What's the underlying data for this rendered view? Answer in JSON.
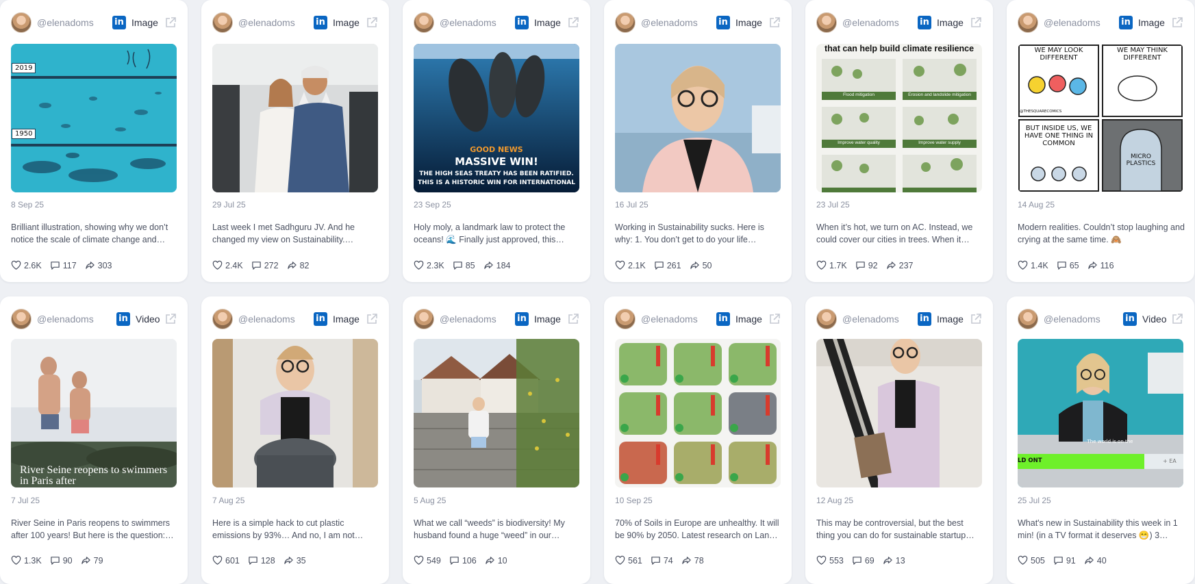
{
  "colors": {
    "linkedin": "#0a66c2",
    "muted": "#8a90a0",
    "card": "#ffffff",
    "bg": "#eef0f4"
  },
  "icons": {
    "network": "linkedin-icon",
    "external": "external-link-icon",
    "like": "heart-icon",
    "comment": "comment-icon",
    "share": "share-icon"
  },
  "cards": [
    {
      "handle": "@elenadoms",
      "type": "Image",
      "date": "8 Sep 25",
      "text": "Brilliant illustration, showing why we don’t notice the scale of climate change and…",
      "likes": "2.6K",
      "comments": "117",
      "shares": "303",
      "thumb": {
        "t1": "2019",
        "t2": "1950"
      }
    },
    {
      "handle": "@elenadoms",
      "type": "Image",
      "date": "29 Jul 25",
      "text": "Last week I met Sadhguru JV. And he changed my view on Sustainability.…",
      "likes": "2.4K",
      "comments": "272",
      "shares": "82"
    },
    {
      "handle": "@elenadoms",
      "type": "Image",
      "date": "23 Sep 25",
      "text": "Holy moly, a landmark law to protect the oceans! 🌊 Finally just approved, this…",
      "likes": "2.3K",
      "comments": "85",
      "shares": "184",
      "thumb": {
        "t1": "GOOD NEWS",
        "t2": "MASSIVE WIN!",
        "t3": "THE HIGH SEAS TREATY HAS BEEN RATIFIED.",
        "t4": "THIS IS A HISTORIC WIN FOR INTERNATIONAL"
      }
    },
    {
      "handle": "@elenadoms",
      "type": "Image",
      "date": "16 Jul 25",
      "text": "Working in Sustainability sucks. Here is why: 1. You don’t get to do your life…",
      "likes": "2.1K",
      "comments": "261",
      "shares": "50"
    },
    {
      "handle": "@elenadoms",
      "type": "Image",
      "date": "23 Jul 25",
      "text": "When it’s hot, we turn on AC. Instead, we could cover our cities in trees. When it…",
      "likes": "1.7K",
      "comments": "92",
      "shares": "237",
      "thumb": {
        "t1": "that can help build climate resilience",
        "b1": "Flood mitigation",
        "b2": "Erosion and landslide mitigation",
        "b3": "Improve water quality",
        "b4": "Improve water supply"
      }
    },
    {
      "handle": "@elenadoms",
      "type": "Image",
      "date": "14 Aug 25",
      "text": "Modern realities. Couldn’t stop laughing and crying at the same time. 🙈",
      "likes": "1.4K",
      "comments": "65",
      "shares": "116",
      "thumb": {
        "t1": "WE MAY LOOK DIFFERENT",
        "t2": "WE MAY THINK DIFFERENT",
        "t3": "BUT INSIDE US, WE HAVE ONE THING IN COMMON",
        "t4": "MICRO PLASTICS",
        "t5": "@THESQUARECOMICS"
      }
    },
    {
      "handle": "@elenadoms",
      "type": "Video",
      "date": "7 Jul 25",
      "text": "River Seine in Paris reopens to swimmers after 100 years! But here is the question:…",
      "likes": "1.3K",
      "comments": "90",
      "shares": "79",
      "thumb": {
        "t1": "River Seine reopens to swimmers in Paris after"
      }
    },
    {
      "handle": "@elenadoms",
      "type": "Image",
      "date": "7 Aug 25",
      "text": "Here is a simple hack to cut plastic emissions by 93%… And no, I am not…",
      "likes": "601",
      "comments": "128",
      "shares": "35"
    },
    {
      "handle": "@elenadoms",
      "type": "Image",
      "date": "5 Aug 25",
      "text": "What we call “weeds” is biodiversity! My husband found a huge “weed” in our…",
      "likes": "549",
      "comments": "106",
      "shares": "10"
    },
    {
      "handle": "@elenadoms",
      "type": "Image",
      "date": "10 Sep 25",
      "text": "70% of Soils in Europe are unhealthy. It will be 90% by 2050. Latest research on Lan…",
      "likes": "561",
      "comments": "74",
      "shares": "78"
    },
    {
      "handle": "@elenadoms",
      "type": "Image",
      "date": "12 Aug 25",
      "text": "This may be controversial, but the best thing you can do for sustainable startup…",
      "likes": "553",
      "comments": "69",
      "shares": "13"
    },
    {
      "handle": "@elenadoms",
      "type": "Video",
      "date": "25 Jul 25",
      "text": "What's new in Sustainability this week in 1 min! (in a TV format it deserves 😁) 3…",
      "likes": "505",
      "comments": "91",
      "shares": "40",
      "thumb": {
        "t1": "The world is on the",
        "t2": "LD ONT",
        "t3": "+ EA"
      }
    }
  ]
}
